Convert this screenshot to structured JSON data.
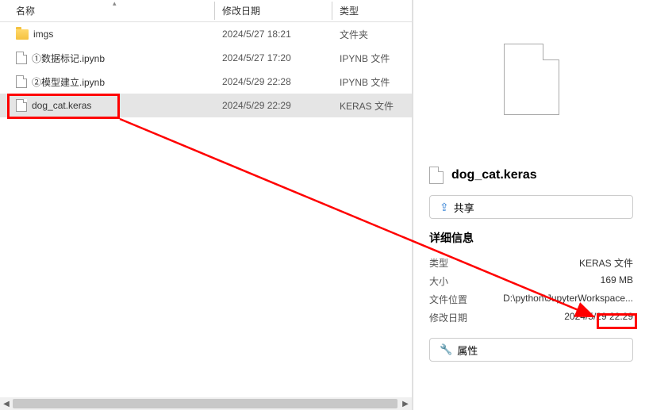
{
  "columns": {
    "name": "名称",
    "date": "修改日期",
    "type": "类型"
  },
  "files": [
    {
      "icon": "folder",
      "name": "imgs",
      "date": "2024/5/27 18:21",
      "type": "文件夹"
    },
    {
      "icon": "file",
      "name": "①数据标记.ipynb",
      "date": "2024/5/27 17:20",
      "type": "IPYNB 文件"
    },
    {
      "icon": "file",
      "name": "②模型建立.ipynb",
      "date": "2024/5/29 22:28",
      "type": "IPYNB 文件"
    },
    {
      "icon": "file",
      "name": "dog_cat.keras",
      "date": "2024/5/29 22:29",
      "type": "KERAS 文件",
      "selected": true
    }
  ],
  "details": {
    "filename": "dog_cat.keras",
    "share_label": "共享",
    "section_title": "详细信息",
    "type_label": "类型",
    "type_value": "KERAS 文件",
    "size_label": "大小",
    "size_value": "169 MB",
    "location_label": "文件位置",
    "location_value": "D:\\python\\JupyterWorkspace...",
    "modified_label": "修改日期",
    "modified_value": "2024/5/29 22:29",
    "props_label": "属性"
  },
  "annotations": {
    "highlight_file_box": true,
    "highlight_size_box": true,
    "arrow_color": "#ff0000"
  }
}
